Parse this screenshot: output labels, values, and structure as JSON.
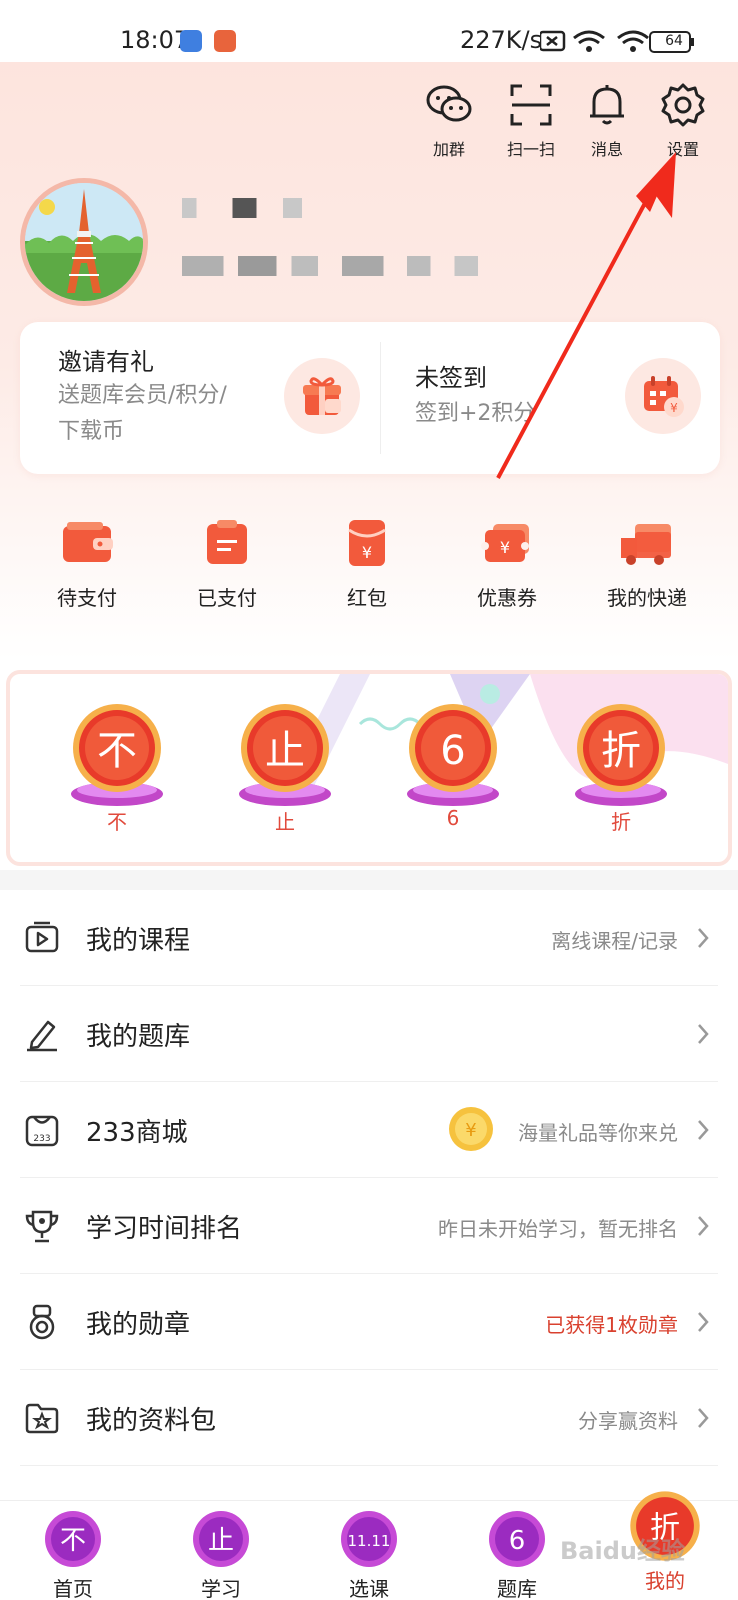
{
  "status_bar": {
    "time": "18:07",
    "network_speed": "227K/s",
    "battery": "64"
  },
  "top_actions": [
    {
      "label": "加群",
      "icon": "wechat-icon"
    },
    {
      "label": "扫一扫",
      "icon": "scan-icon"
    },
    {
      "label": "消息",
      "icon": "bell-icon"
    },
    {
      "label": "设置",
      "icon": "gear-icon"
    }
  ],
  "promo": {
    "invite_title": "邀请有礼",
    "invite_sub_line1": "送题库会员/积分/",
    "invite_sub_line2": "下载币",
    "checkin_title": "未签到",
    "checkin_sub": "签到+2积分"
  },
  "orders": [
    {
      "label": "待支付",
      "icon": "wallet-icon"
    },
    {
      "label": "已支付",
      "icon": "paid-icon"
    },
    {
      "label": "红包",
      "icon": "red-packet-icon"
    },
    {
      "label": "优惠券",
      "icon": "coupon-icon"
    },
    {
      "label": "我的快递",
      "icon": "truck-icon"
    }
  ],
  "banner": {
    "badges": [
      {
        "glyph": "不",
        "caption": "不"
      },
      {
        "glyph": "止",
        "caption": "止"
      },
      {
        "glyph": "6",
        "caption": "6"
      },
      {
        "glyph": "折",
        "caption": "折"
      }
    ]
  },
  "menu": [
    {
      "label": "我的课程",
      "right": "离线课程/记录",
      "icon": "course-icon",
      "right_color": "gray"
    },
    {
      "label": "我的题库",
      "right": "",
      "icon": "pencil-icon",
      "right_color": "gray"
    },
    {
      "label": "233商城",
      "right": "海量礼品等你来兑",
      "icon": "store-icon",
      "right_color": "gray",
      "coin_icon": "coin-icon"
    },
    {
      "label": "学习时间排名",
      "right": "昨日未开始学习，暂无排名",
      "icon": "trophy-icon",
      "right_color": "gray"
    },
    {
      "label": "我的勋章",
      "right": "已获得1枚勋章",
      "icon": "medal-icon",
      "right_color": "red"
    },
    {
      "label": "我的资料包",
      "right": "分享赢资料",
      "icon": "folder-icon",
      "right_color": "gray"
    }
  ],
  "tabs": [
    {
      "label": "首页",
      "glyph": "不",
      "active": false
    },
    {
      "label": "学习",
      "glyph": "止",
      "active": false
    },
    {
      "label": "选课",
      "glyph": "11.11",
      "active": false
    },
    {
      "label": "题库",
      "glyph": "6",
      "active": false
    },
    {
      "label": "我的",
      "glyph": "折",
      "active": true
    }
  ],
  "watermark": "Baidu经验"
}
